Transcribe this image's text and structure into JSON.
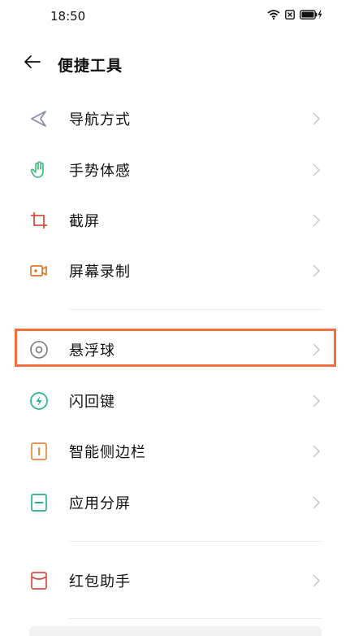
{
  "status": {
    "time": "18:50",
    "icons": [
      "wifi-icon",
      "sim-off-icon",
      "battery-charging-icon"
    ]
  },
  "header": {
    "title": "便捷工具",
    "back_icon": "arrow-left-icon"
  },
  "items": [
    {
      "label": "导航方式",
      "icon": "navigation-icon",
      "color": "#8a8fa8"
    },
    {
      "label": "手势体感",
      "icon": "hand-gesture-icon",
      "color": "#3cb878"
    },
    {
      "label": "截屏",
      "icon": "crop-icon",
      "color": "#d6533c"
    },
    {
      "label": "屏幕录制",
      "icon": "video-record-icon",
      "color": "#e0772f"
    },
    {
      "label": "悬浮球",
      "icon": "floating-ball-icon",
      "color": "#7a7a7a"
    },
    {
      "label": "闪回键",
      "icon": "flash-back-icon",
      "color": "#24b58e"
    },
    {
      "label": "智能侧边栏",
      "icon": "smart-sidebar-icon",
      "color": "#e28a3c"
    },
    {
      "label": "应用分屏",
      "icon": "split-screen-icon",
      "color": "#2fab8c"
    },
    {
      "label": "红包助手",
      "icon": "red-envelope-icon",
      "color": "#d9503f"
    }
  ],
  "highlight_color": "#f07040"
}
